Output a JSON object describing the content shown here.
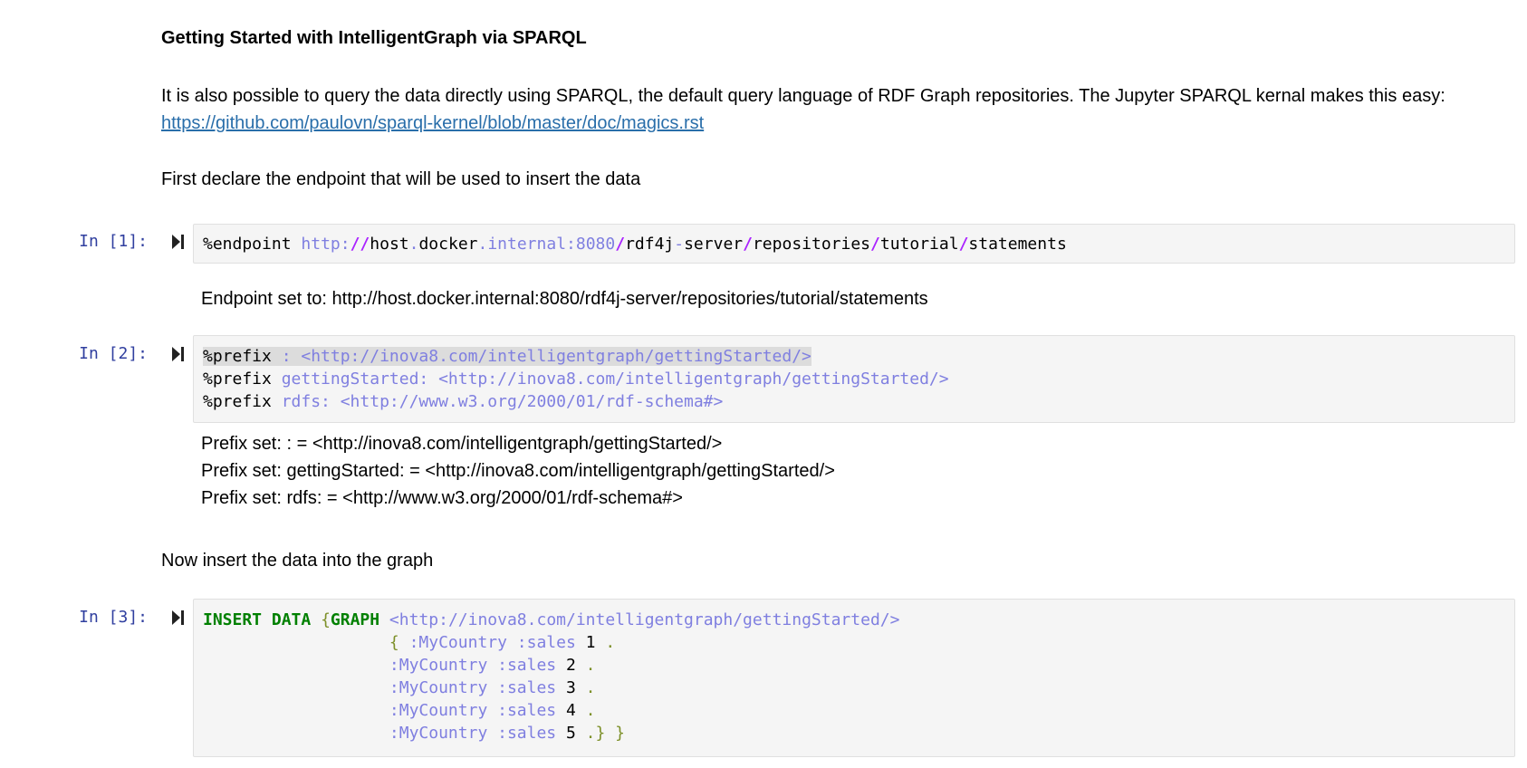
{
  "md": {
    "heading": "Getting Started with IntelligentGraph via SPARQL",
    "intro_text": "It is also possible to query the data directly using SPARQL, the default query language of RDF Graph repositories. The Jupyter SPARQL kernal makes this easy: ",
    "intro_link": "https://github.com/paulovn/sparql-kernel/blob/master/doc/magics.rst",
    "declare_text": "First declare the endpoint that will be used to insert the data",
    "insert_text": "Now insert the data into the graph"
  },
  "cells": [
    {
      "prompt": "In [1]:",
      "code": {
        "magic": "%endpoint",
        "sp": " ",
        "scheme": "http:",
        "slashes": "//",
        "host1": "host",
        "dot1": ".",
        "host2": "docker",
        "host3": ".internal:8080",
        "s1": "/",
        "p1": "rdf4j",
        "dash": "-",
        "p2": "server",
        "s2": "/",
        "p3": "repositories",
        "s3": "/",
        "p4": "tutorial",
        "s4": "/",
        "p5": "statements"
      },
      "output": [
        "Endpoint set to: http://host.docker.internal:8080/rdf4j-server/repositories/tutorial/statements"
      ]
    },
    {
      "prompt": "In [2]:",
      "code": {
        "l1_magic": "%prefix",
        "l1_rest": " : <http://inova8.com/intelligentgraph/gettingStarted/>",
        "l2_magic": "%prefix",
        "l2_rest": " gettingStarted: <http://inova8.com/intelligentgraph/gettingStarted/>",
        "l3_magic": "%prefix",
        "l3_rest": " rdfs: <http://www.w3.org/2000/01/rdf-schema#>"
      },
      "output": [
        "Prefix set: : = <http://inova8.com/intelligentgraph/gettingStarted/>",
        "Prefix set: gettingStarted: = <http://inova8.com/intelligentgraph/gettingStarted/>",
        "Prefix set: rdfs: = <http://www.w3.org/2000/01/rdf-schema#>"
      ]
    },
    {
      "prompt": "In [3]:",
      "code": {
        "kw_insert": "INSERT DATA",
        "sp": " ",
        "brace_open": "{",
        "kw_graph": "GRAPH",
        "graph_iri": " <http://inova8.com/intelligentgraph/gettingStarted/>",
        "indent": "                   ",
        "inner_brace": "{",
        "triples": [
          {
            "subj_pred": " :MyCountry :sales ",
            "num": "1",
            "end": " ."
          },
          {
            "subj_pred": ":MyCountry :sales ",
            "num": "2",
            "end": " ."
          },
          {
            "subj_pred": ":MyCountry :sales ",
            "num": "3",
            "end": " ."
          },
          {
            "subj_pred": ":MyCountry :sales ",
            "num": "4",
            "end": " ."
          },
          {
            "subj_pred": ":MyCountry :sales ",
            "num": "5",
            "end": " .} }"
          }
        ]
      },
      "output": []
    }
  ],
  "icons": {
    "run": "run-cell-icon"
  },
  "colors": {
    "prompt": "#303f9f",
    "link": "#296eaa",
    "keyword": "#008000",
    "iri": "#7f7fe0",
    "slash": "#aa22ff",
    "punct": "#7d9029"
  }
}
